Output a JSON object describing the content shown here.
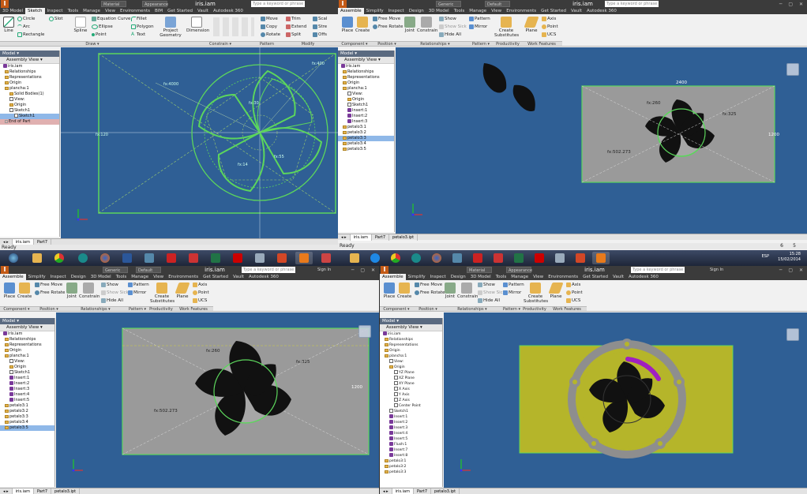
{
  "q1": {
    "tabs": [
      "3D Model",
      "Sketch",
      "Inspect",
      "Tools",
      "Manage",
      "View",
      "Environments",
      "BIM",
      "Get Started",
      "Vault",
      "Autodesk 360"
    ],
    "active_tab": "Sketch",
    "ribbon": {
      "line": "Line",
      "circle": "Circle",
      "arc": "Arc",
      "rectangle": "Rectangle",
      "slot": "Slot",
      "spline": "Spline",
      "eq_curve": "Equation Curve",
      "ellipse": "Ellipse",
      "point": "Point",
      "fillet": "Fillet",
      "polygon": "Polygon",
      "text": "Text",
      "project": "Project Geometry",
      "dimension": "Dimension",
      "move": "Move",
      "copy": "Copy",
      "rotate": "Rotate",
      "trim": "Trim",
      "extend": "Extend",
      "split": "Split",
      "scale": "Scal",
      "stretch": "Stre",
      "offset": "Offs"
    },
    "panels": {
      "draw": "Draw ▾",
      "constrain": "Constrain ▾",
      "pattern": "Pattern",
      "modify": "Modify"
    },
    "title": "iris.iam",
    "search": "Type a keyword or phrase",
    "dd1": "Material",
    "dd2": "Appearance",
    "tree": {
      "header": "Model ▾",
      "view": "Assembly View ▾",
      "items": [
        "iris.iam",
        "Relationships",
        "Representations",
        "Origin",
        "plancha:1",
        "Solid Bodies(1)",
        "View:",
        "Origin",
        "Sketch1",
        "Sketch1",
        "End of Part"
      ]
    },
    "docs": [
      "iris.iam",
      "Part7"
    ],
    "dims": [
      "fx:400",
      "fx:4000",
      "fx:30",
      "fx:55",
      "fx:14",
      "fx:120"
    ],
    "status": "Ready"
  },
  "q2": {
    "tabs": [
      "Assemble",
      "Simplify",
      "Inspect",
      "Design",
      "3D Model",
      "Tools",
      "Manage",
      "View",
      "Environments",
      "Get Started",
      "Vault",
      "Autodesk 360"
    ],
    "active_tab": "Assemble",
    "ribbon": {
      "place": "Place",
      "create": "Create",
      "free_move": "Free Move",
      "free_rotate": "Free Rotate",
      "joint": "Joint",
      "constrain": "Constrain",
      "show": "Show",
      "show_sick": "Show Sick",
      "hide_all": "Hide All",
      "pattern": "Pattern",
      "mirror": "Mirror",
      "substitutes": "Create Substitutes",
      "plane": "Plane",
      "axis": "Axis",
      "point": "Point",
      "ucs": "UCS"
    },
    "panels": {
      "component": "Component ▾",
      "position": "Position ▾",
      "relationships": "Relationships ▾",
      "pattern": "Pattern ▾",
      "productivity": "Productivity",
      "work_features": "Work Features"
    },
    "title": "iris.iam",
    "search": "Type a keyword or phrase",
    "dd1": "Generic",
    "dd2": "Default",
    "tree": {
      "header": "Model ▾",
      "view": "Assembly View ▾",
      "items": [
        "iris.iam",
        "Relationships",
        "Representations",
        "Origin",
        "plancha:1",
        "View:",
        "Origin",
        "Sketch1",
        "Insert:1",
        "Insert:2",
        "Insert:3",
        "petalo3:1",
        "petalo3:2",
        "petalo3:3",
        "petalo3:4",
        "petalo3:5"
      ]
    },
    "docs": [
      "iris.iam",
      "Part7",
      "petalo3.ipt"
    ],
    "dims": [
      "2400",
      "fx:260",
      "fx:325",
      "fx:502.273",
      "1200"
    ],
    "status": "Ready",
    "page": [
      "6",
      "5"
    ]
  },
  "taskbar": {
    "lang": "ESP",
    "time": "15:28",
    "date": "15/02/2014"
  },
  "q3": {
    "tabs": [
      "Assemble",
      "Simplify",
      "Inspect",
      "Design",
      "3D Model",
      "Tools",
      "Manage",
      "View",
      "Environments",
      "Get Started",
      "Vault",
      "Autodesk 360"
    ],
    "active_tab": "Assemble",
    "title": "iris.iam",
    "search": "Type a keyword or phrase",
    "sign": "Sign In",
    "dd1": "Generic",
    "dd2": "Default",
    "tree": {
      "header": "Model ▾",
      "view": "Assembly View ▾",
      "items": [
        "iris.iam",
        "Relationships",
        "Representations",
        "Origin",
        "plancha:1",
        "View:",
        "Origin",
        "Sketch1",
        "Insert:1",
        "Insert:2",
        "Insert:3",
        "Insert:4",
        "Insert:5",
        "petalo3:1",
        "petalo3:2",
        "petalo3:3",
        "petalo3:4",
        "petalo3:5"
      ]
    },
    "docs": [
      "iris.iam",
      "Part7",
      "petalo3.ipt"
    ],
    "dims": [
      "fx:260",
      "fx:325",
      "fx:502.273",
      "1200"
    ]
  },
  "q4": {
    "tabs": [
      "Assemble",
      "Simplify",
      "Inspect",
      "Design",
      "3D Model",
      "Tools",
      "Manage",
      "View",
      "Environments",
      "Get Started",
      "Vault",
      "Autodesk 360"
    ],
    "active_tab": "Assemble",
    "title": "iris.iam",
    "search": "Type a keyword or phrase",
    "sign": "Sign In",
    "dd1": "Material",
    "dd2": "Appearance",
    "tree": {
      "header": "Model ▾",
      "view": "Assembly View ▾",
      "items": [
        "iris.iam",
        "Relationships",
        "Representations",
        "Origin",
        "plancha:1",
        "View:",
        "Origin",
        "YZ Plane",
        "XZ Plane",
        "XY Plane",
        "X Axis",
        "Y Axis",
        "Z Axis",
        "Center Point",
        "Sketch1",
        "Insert:1",
        "Insert:2",
        "Insert:3",
        "Insert:4",
        "Insert:5",
        "Flush:1",
        "Insert:7",
        "Insert:8",
        "petalo3:1",
        "petalo3:2",
        "petalo3:3"
      ]
    },
    "docs": [
      "iris.iam",
      "Part7",
      "petalo3.ipt"
    ]
  },
  "colors": {
    "viewport": "#2f5f95",
    "sketch": "#5cd65c",
    "plate_grey": "#9a9a9a",
    "plate_yellow": "#b5b52a",
    "petal": "#111111",
    "accent": "#c45a16"
  }
}
